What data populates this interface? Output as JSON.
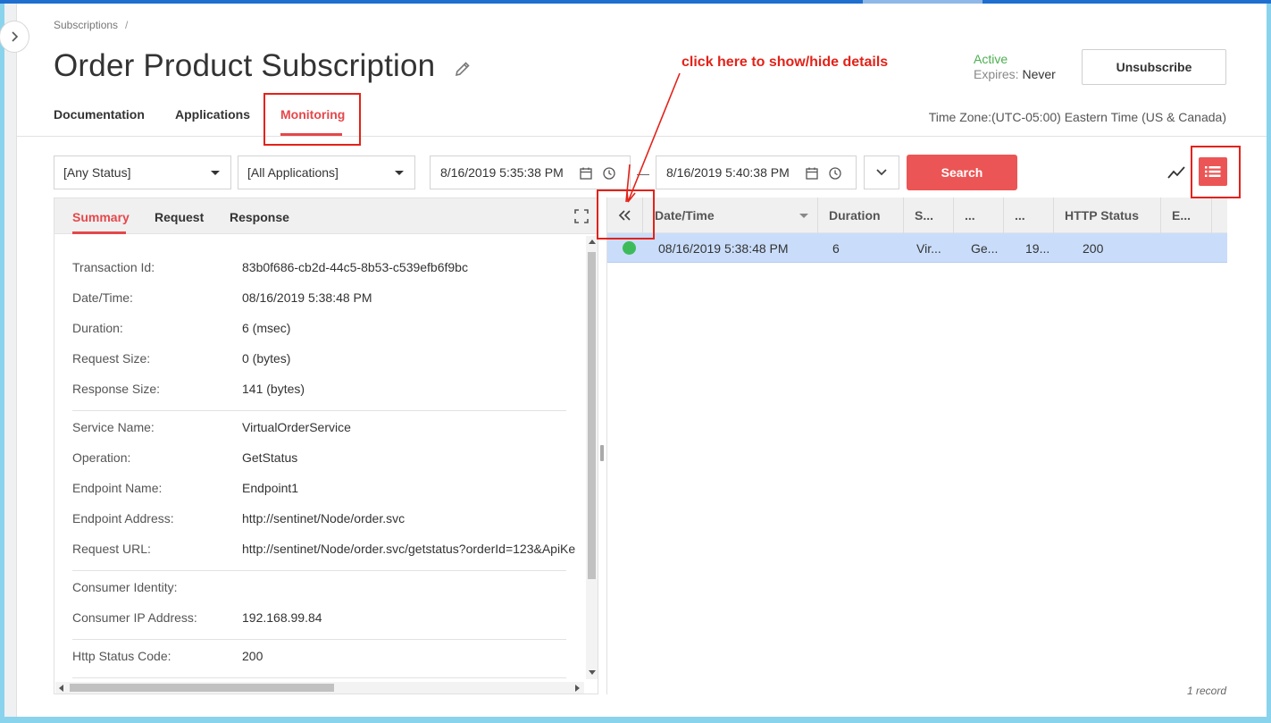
{
  "breadcrumb": {
    "item": "Subscriptions",
    "separator": "/"
  },
  "header": {
    "title": "Order Product Subscription",
    "status": "Active",
    "expires_label": "Expires:",
    "expires_value": "Never",
    "unsubscribe_label": "Unsubscribe"
  },
  "tabs": [
    {
      "label": "Documentation"
    },
    {
      "label": "Applications"
    },
    {
      "label": "Monitoring",
      "active": true
    }
  ],
  "timezone": "Time Zone:(UTC-05:00) Eastern Time (US & Canada)",
  "filters": {
    "status": "[Any Status]",
    "applications": "[All Applications]",
    "from_date": "8/16/2019 5:35:38 PM",
    "to_date": "8/16/2019 5:40:38 PM",
    "search_label": "Search"
  },
  "annotation": {
    "text": "click here to show/hide details"
  },
  "details": {
    "tabs": [
      {
        "label": "Summary",
        "active": true
      },
      {
        "label": "Request"
      },
      {
        "label": "Response"
      }
    ],
    "rows": [
      {
        "label": "Transaction Id:",
        "value": "83b0f686-cb2d-44c5-8b53-c539efb6f9bc"
      },
      {
        "label": "Date/Time:",
        "value": "08/16/2019 5:38:48 PM"
      },
      {
        "label": "Duration:",
        "value": "6 (msec)"
      },
      {
        "label": "Request Size:",
        "value": "0 (bytes)"
      },
      {
        "label": "Response Size:",
        "value": "141 (bytes)"
      },
      {
        "label": "Service Name:",
        "value": "VirtualOrderService"
      },
      {
        "label": "Operation:",
        "value": "GetStatus"
      },
      {
        "label": "Endpoint Name:",
        "value": "Endpoint1"
      },
      {
        "label": "Endpoint Address:",
        "value": "http://sentinet/Node/order.svc"
      },
      {
        "label": "Request URL:",
        "value": "http://sentinet/Node/order.svc/getstatus?orderId=123&ApiKe"
      },
      {
        "label": "Consumer Identity:",
        "value": ""
      },
      {
        "label": "Consumer IP Address:",
        "value": "192.168.99.84"
      },
      {
        "label": "Http Status Code:",
        "value": "200"
      }
    ]
  },
  "grid": {
    "columns": [
      "Date/Time",
      "Duration",
      "S...",
      "...",
      "...",
      "HTTP Status",
      "E..."
    ],
    "rows": [
      {
        "status_color": "#3dbb5b",
        "cells": [
          "08/16/2019 5:38:48 PM",
          "6",
          "Vir...",
          "Ge...",
          "19...",
          "200",
          ""
        ]
      }
    ],
    "record_count": "1 record"
  },
  "colors": {
    "accent": "#e5474b",
    "button": "#ec5555",
    "active_status": "#4caf50",
    "selected_row": "#c9ddfa",
    "annotation": "#e32219"
  }
}
